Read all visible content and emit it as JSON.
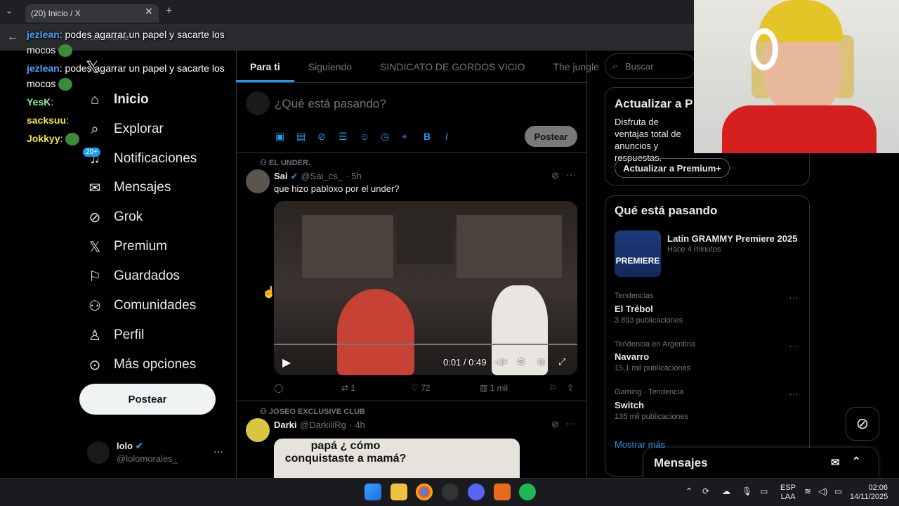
{
  "browser": {
    "tab_title": "(20) Inicio / X",
    "address": "x.com/home"
  },
  "chat": [
    {
      "user": "jezlean",
      "text": "podes agarrar un papel y sacarte los mocos"
    },
    {
      "user": "jezlean",
      "text": "podes agarrar un papel y sacarte los mocos"
    },
    {
      "user": "YesK",
      "text": ""
    },
    {
      "user": "sacksuu",
      "text": ""
    },
    {
      "user": "Jokkyy",
      "text": ""
    }
  ],
  "nav": {
    "items": [
      {
        "label": "Inicio",
        "icon": "home-icon"
      },
      {
        "label": "Explorar",
        "icon": "search-icon"
      },
      {
        "label": "Notificaciones",
        "icon": "bell-icon"
      },
      {
        "label": "Mensajes",
        "icon": "mail-icon"
      },
      {
        "label": "Grok",
        "icon": "grok-icon"
      },
      {
        "label": "Premium",
        "icon": "x-logo-icon"
      },
      {
        "label": "Guardados",
        "icon": "bookmark-icon"
      },
      {
        "label": "Comunidades",
        "icon": "people-icon"
      },
      {
        "label": "Perfil",
        "icon": "person-icon"
      },
      {
        "label": "Más opciones",
        "icon": "more-circle-icon"
      }
    ],
    "notif_badge": "20+",
    "post_label": "Postear"
  },
  "account": {
    "name": "lolo",
    "handle": "@lolomorales_"
  },
  "feed": {
    "tabs": [
      "Para ti",
      "Siguiendo",
      "SINDICATO DE GORDOS VICIO",
      "The jungle"
    ],
    "composer_placeholder": "¿Qué está pasando?",
    "composer_post": "Postear",
    "tweets": [
      {
        "context": "EL UNDER.",
        "name": "Sai",
        "handle": "@Sai_cs_",
        "time": "· 5h",
        "text": "que hizo pabloxo por el under?",
        "video_time": "0:01 / 0:49",
        "replies": "",
        "retweets": "1",
        "likes": "72",
        "views": "1 mil"
      },
      {
        "context": "JOSEO EXCLUSIVE CLUB",
        "name": "Darki",
        "handle": "@DarkiiiRg",
        "time": "· 4h",
        "image_text": "papá ¿ cómo conquistaste a mamá?"
      }
    ]
  },
  "sidebar": {
    "search_placeholder": "Buscar",
    "premium_title": "Actualizar a P",
    "premium_text": "Disfruta de ventajas total de anuncios y respuestas.",
    "premium_button": "Actualizar a Premium+",
    "trends_title": "Qué está pasando",
    "featured": {
      "title": "Latin GRAMMY Premiere 2025",
      "meta": "Hace 4 minutos",
      "badge": "PREMIERE"
    },
    "trends": [
      {
        "meta": "Tendencias",
        "title": "El Trébol",
        "count": "3.893 publicaciones"
      },
      {
        "meta": "Tendencia en Argentina",
        "title": "Navarro",
        "count": "15,1 mil publicaciones"
      },
      {
        "meta": "Gaming · Tendencia",
        "title": "Switch",
        "count": "135 mil publicaciones"
      }
    ],
    "show_more": "Mostrar más",
    "messages_title": "Mensajes"
  },
  "taskbar": {
    "lang": "ESP",
    "lang2": "LAA",
    "time": "02:06",
    "date": "14/11/2025"
  }
}
